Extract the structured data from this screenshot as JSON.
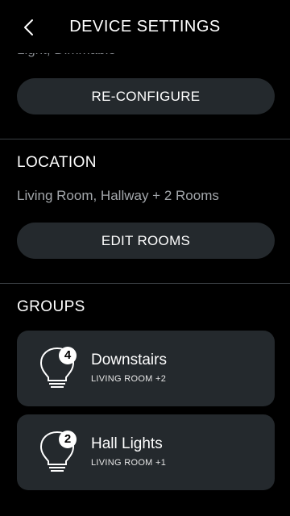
{
  "header": {
    "title": "DEVICE SETTINGS",
    "back_icon": "chevron-left-icon"
  },
  "cutoff_text": "Light, Dimmable",
  "reconfigure_label": "RE-CONFIGURE",
  "location": {
    "heading": "LOCATION",
    "rooms_text": "Living Room, Hallway + 2 Rooms",
    "edit_label": "EDIT ROOMS"
  },
  "groups": {
    "heading": "GROUPS",
    "items": [
      {
        "name": "Downstairs",
        "sub": "LIVING ROOM +2",
        "count": "4",
        "icon": "lightbulb-icon"
      },
      {
        "name": "Hall Lights",
        "sub": "LIVING ROOM +1",
        "count": "2",
        "icon": "lightbulb-icon"
      }
    ]
  },
  "colors": {
    "background": "#000000",
    "surface": "#24292d",
    "divider": "#3a3f44",
    "muted_text": "#a3a7ab"
  }
}
